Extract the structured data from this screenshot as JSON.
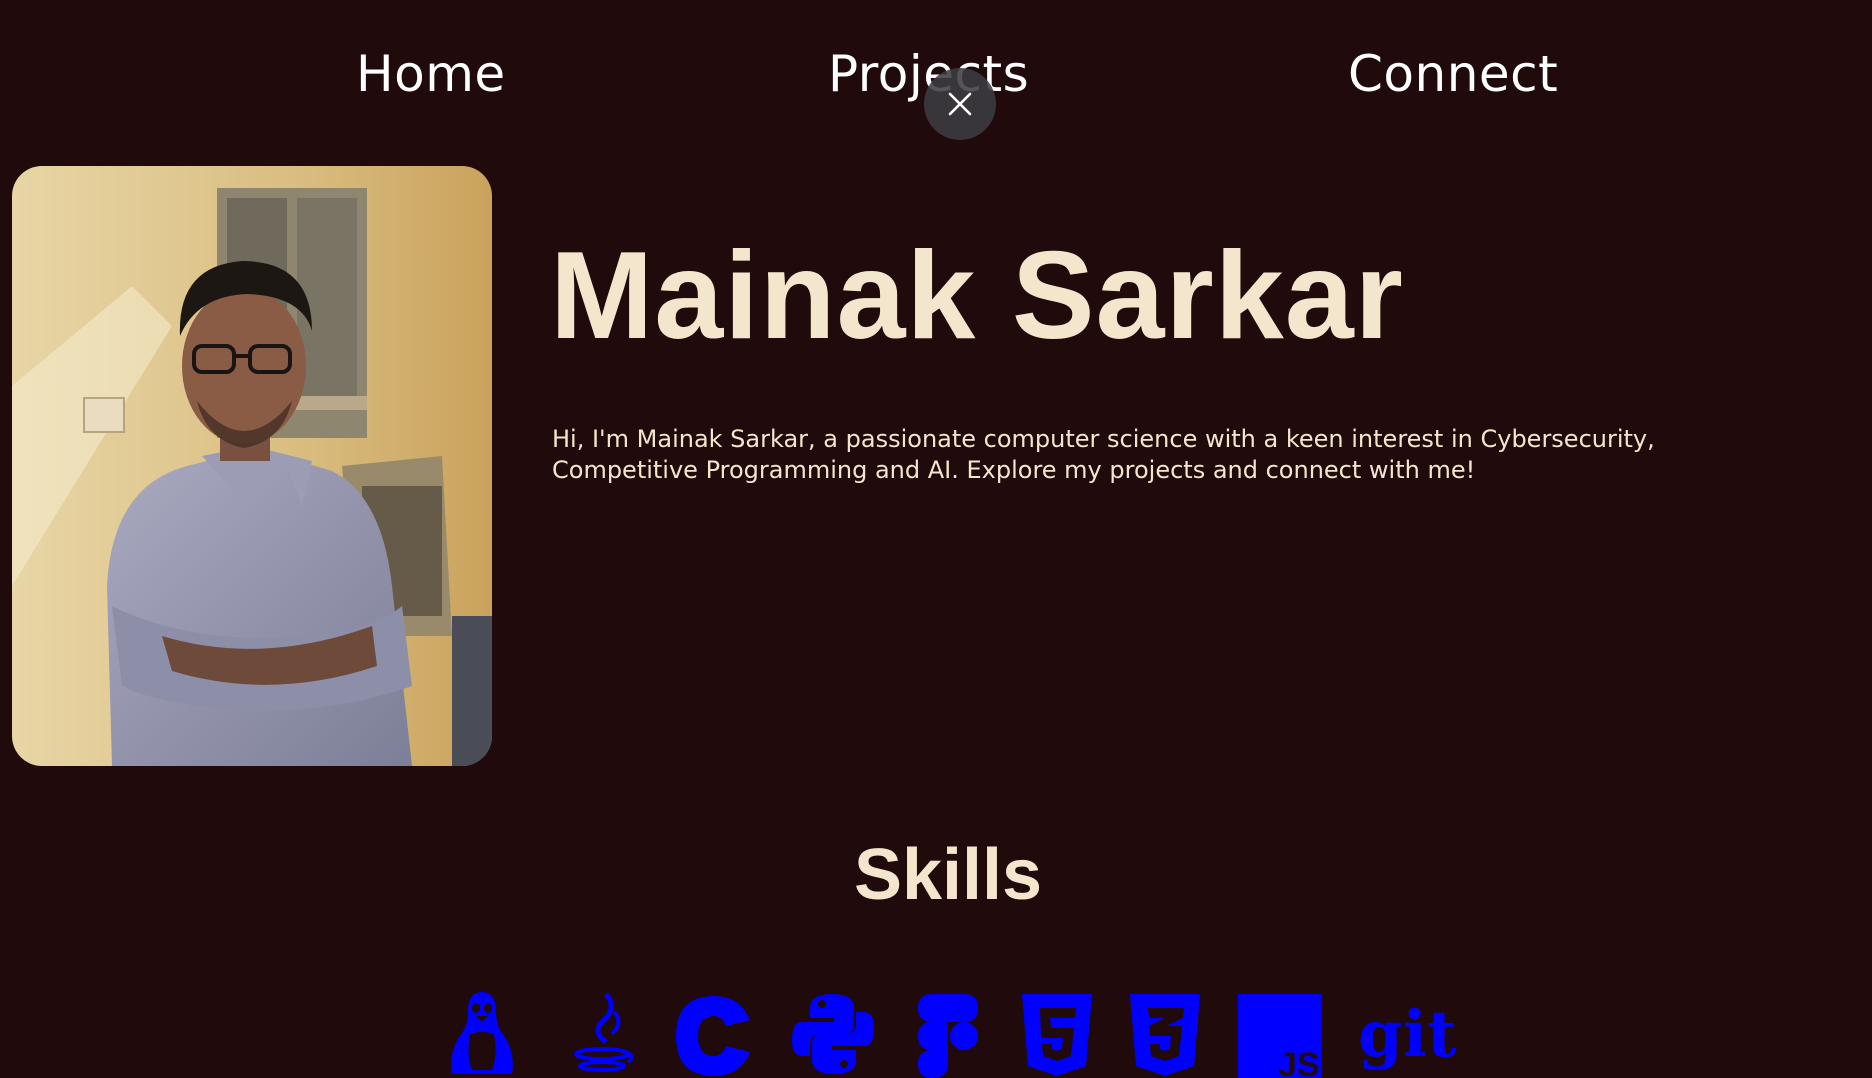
{
  "nav": {
    "home": "Home",
    "projects": "Projects",
    "connect": "Connect"
  },
  "overlay": {
    "close_icon": "close-icon"
  },
  "hero": {
    "name": "Mainak Sarkar",
    "bio": "Hi, I'm Mainak Sarkar, a passionate computer science with a keen interest in Cybersecurity, Competitive Programming and AI. Explore my projects and connect with me!"
  },
  "skills": {
    "title": "Skills",
    "icons": [
      "linux-icon",
      "java-icon",
      "c-icon",
      "python-icon",
      "figma-icon",
      "html5-icon",
      "css3-icon",
      "javascript-icon",
      "git-icon"
    ]
  },
  "colors": {
    "background": "#200a0c",
    "heading": "#f3e6cc",
    "skill_icon": "#0000ff"
  }
}
